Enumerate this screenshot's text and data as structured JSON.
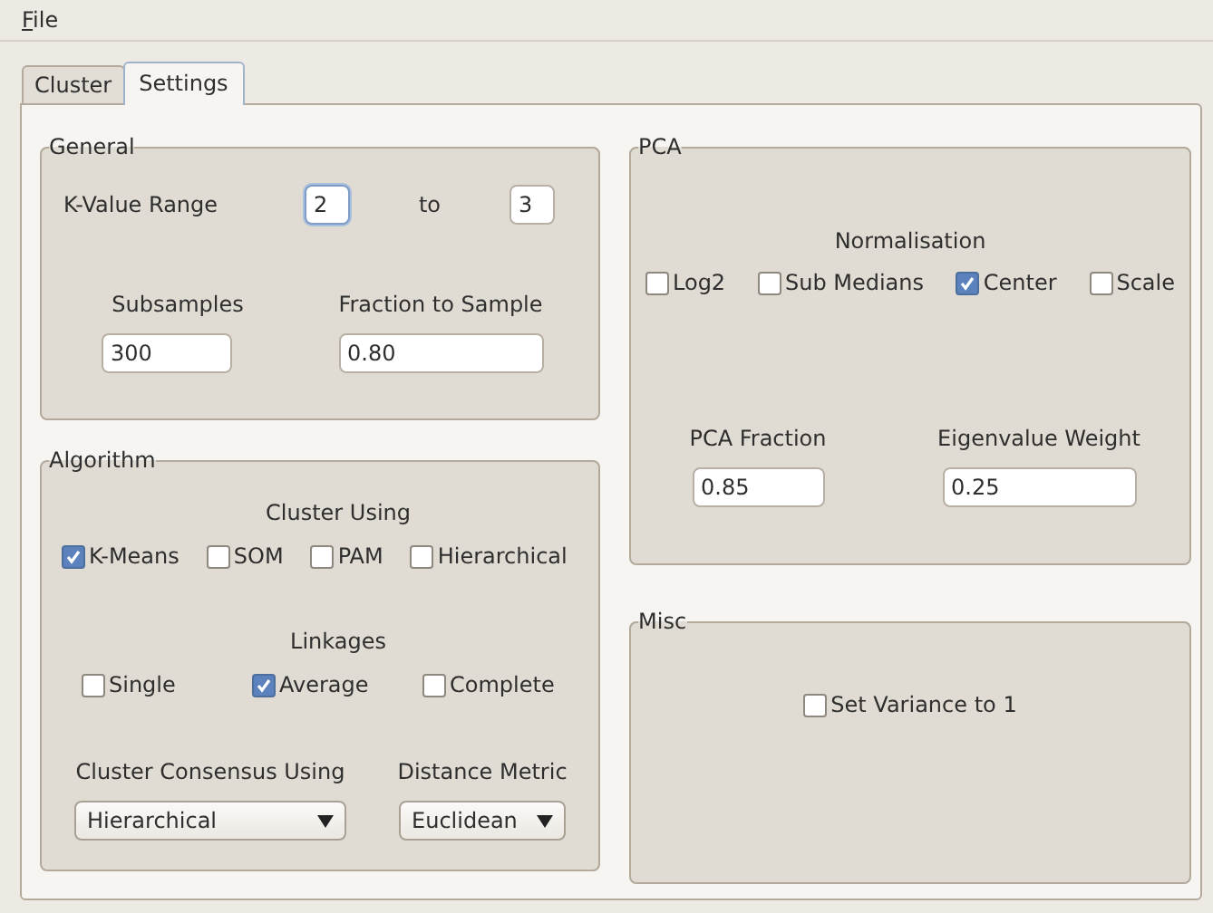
{
  "menu": [
    {
      "label": "File"
    }
  ],
  "tabs": [
    {
      "label": "Cluster",
      "selected": false
    },
    {
      "label": "Settings",
      "selected": true
    }
  ],
  "general": {
    "title": "General",
    "k_label": "K-Value Range",
    "k_from": {
      "value": "2",
      "focused": true
    },
    "to_label": "to",
    "k_to": {
      "value": "3",
      "focused": false
    },
    "subsamples_label": "Subsamples",
    "subsamples": "300",
    "fraction_label": "Fraction to Sample",
    "fraction": "0.80"
  },
  "algorithm": {
    "title": "Algorithm",
    "cluster_using_label": "Cluster Using",
    "cluster_using": [
      {
        "label": "K-Means",
        "checked": true
      },
      {
        "label": "SOM",
        "checked": false
      },
      {
        "label": "PAM",
        "checked": false
      },
      {
        "label": "Hierarchical",
        "checked": false
      }
    ],
    "linkages_label": "Linkages",
    "linkages": [
      {
        "label": "Single",
        "checked": false
      },
      {
        "label": "Average",
        "checked": true
      },
      {
        "label": "Complete",
        "checked": false
      }
    ],
    "consensus_label": "Cluster Consensus Using",
    "consensus": "Hierarchical",
    "metric_label": "Distance Metric",
    "metric": "Euclidean"
  },
  "pca": {
    "title": "PCA",
    "normalisation_label": "Normalisation",
    "normalisation": [
      {
        "label": "Log2",
        "checked": false
      },
      {
        "label": "Sub Medians",
        "checked": false
      },
      {
        "label": "Center",
        "checked": true
      },
      {
        "label": "Scale",
        "checked": false
      }
    ],
    "fraction_label": "PCA Fraction",
    "fraction": "0.85",
    "weight_label": "Eigenvalue Weight",
    "weight": "0.25"
  },
  "misc": {
    "title": "Misc",
    "options": [
      {
        "label": "Set Variance to 1",
        "checked": false
      }
    ]
  }
}
